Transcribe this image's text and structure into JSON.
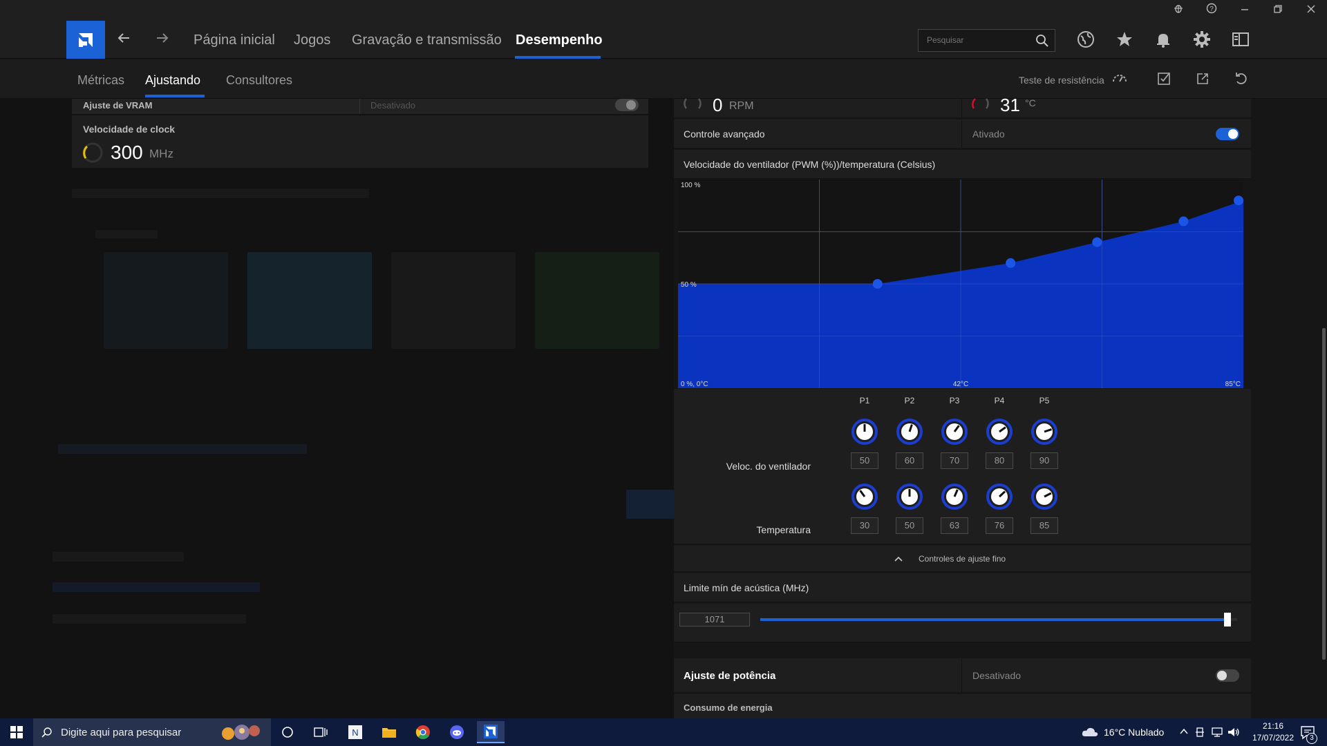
{
  "nav": {
    "items": [
      "Página inicial",
      "Jogos",
      "Gravação e transmissão",
      "Desempenho"
    ],
    "active": "Desempenho",
    "search_placeholder": "Pesquisar"
  },
  "subnav": {
    "items": [
      "Métricas",
      "Ajustando",
      "Consultores"
    ],
    "active": "Ajustando",
    "stress_test": "Teste de resistência"
  },
  "left": {
    "partial_label": "Ajuste de VRAM",
    "partial_state": "Desativado",
    "clock_title": "Velocidade de clock",
    "clock_value": "300",
    "clock_unit": "MHz"
  },
  "right": {
    "fan_rpm_value": "0",
    "fan_rpm_unit": "RPM",
    "temp_value": "31",
    "temp_unit": "°C",
    "advanced_label": "Controle avançado",
    "advanced_state": "Ativado",
    "chart_title": "Velocidade do ventilador (PWM (%))/temperatura (Celsius)",
    "fan_label": "Veloc. do ventilador",
    "temp_label": "Temperatura",
    "fine_tune": "Controles de ajuste fino",
    "acoustic_label": "Limite mín de acústica (MHz)",
    "acoustic_value": "1071",
    "acoustic_fraction": 0.98,
    "power_label": "Ajuste de potência",
    "power_state": "Desativado",
    "energy_label": "Consumo de energia",
    "points": [
      {
        "name": "P1",
        "fan": "50",
        "temp": "30"
      },
      {
        "name": "P2",
        "fan": "60",
        "temp": "50"
      },
      {
        "name": "P3",
        "fan": "70",
        "temp": "63"
      },
      {
        "name": "P4",
        "fan": "80",
        "temp": "76"
      },
      {
        "name": "P5",
        "fan": "90",
        "temp": "85"
      }
    ]
  },
  "chart_data": {
    "type": "area",
    "x": [
      0,
      30,
      50,
      63,
      76,
      85
    ],
    "y": [
      50,
      50,
      60,
      70,
      80,
      90
    ],
    "xlim": [
      0,
      85
    ],
    "ylim": [
      0,
      100
    ],
    "y_labels": [
      "100 %",
      "50 %"
    ],
    "x_labels": [
      "0 %, 0°C",
      "42°C",
      "85°C"
    ],
    "fill_color": "#0a36c8",
    "point_color": "#1c56e8"
  },
  "taskbar": {
    "search_placeholder": "Digite aqui para pesquisar",
    "weather": "16°C  Nublado",
    "time": "21:16",
    "date": "17/07/2022",
    "notif_count": "3"
  },
  "colors": {
    "accent": "#1b62d6",
    "chart_fill": "#0a36c8"
  }
}
